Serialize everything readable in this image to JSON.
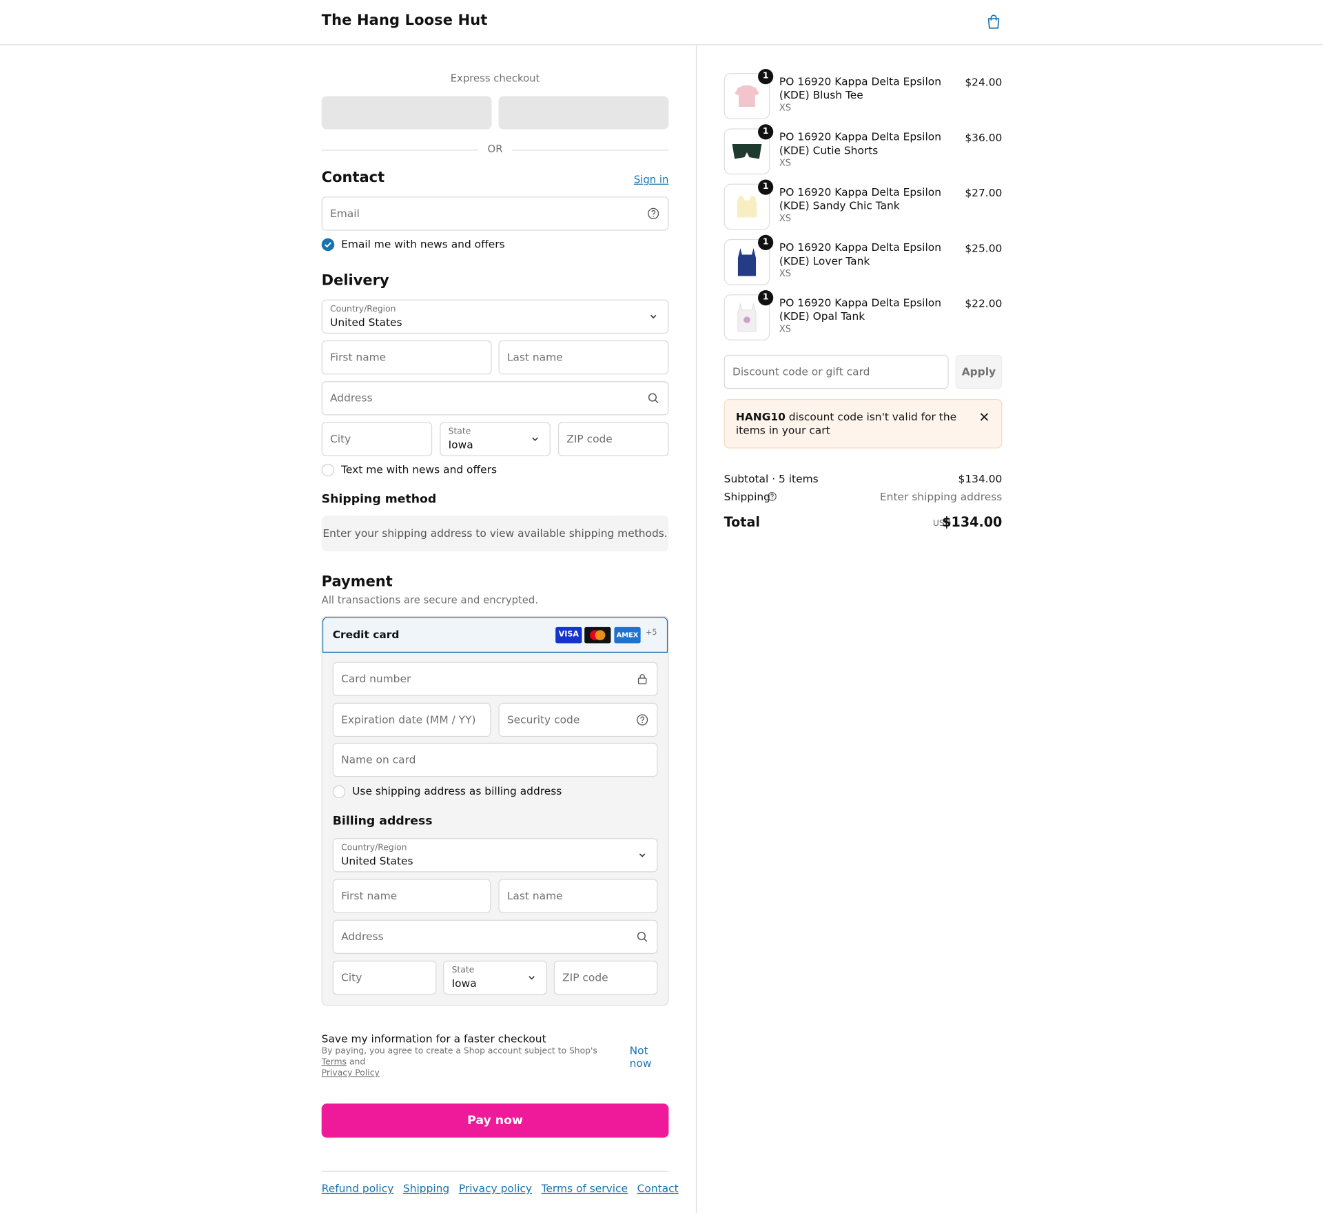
{
  "header": {
    "shop_name": "The Hang Loose Hut",
    "cart_icon": "shopping-bag-icon"
  },
  "express": {
    "title": "Express checkout",
    "or": "OR"
  },
  "contact": {
    "title": "Contact",
    "sign_in": "Sign in",
    "email_placeholder": "Email",
    "newsletter_label": "Email me with news and offers",
    "newsletter_checked": true
  },
  "delivery": {
    "title": "Delivery",
    "country_label": "Country/Region",
    "country_value": "United States",
    "first_name": "First name",
    "last_name": "Last name",
    "address": "Address",
    "city": "City",
    "state_label": "State",
    "state_value": "Iowa",
    "zip": "ZIP code",
    "sms_label": "Text me with news and offers",
    "sms_checked": false
  },
  "shipping_method": {
    "title": "Shipping method",
    "note": "Enter your shipping address to view available shipping methods."
  },
  "payment": {
    "title": "Payment",
    "subtitle": "All transactions are secure and encrypted.",
    "method": "Credit card",
    "brands": [
      "VISA",
      "MC",
      "AMEX"
    ],
    "more_brands": "+5",
    "card_number": "Card number",
    "expiration": "Expiration date (MM / YY)",
    "security_code": "Security code",
    "name_on_card": "Name on card",
    "billing_same_label": "Use shipping address as billing address",
    "billing_same_checked": false
  },
  "billing": {
    "title": "Billing address",
    "country_label": "Country/Region",
    "country_value": "United States",
    "first_name": "First name",
    "last_name": "Last name",
    "address": "Address",
    "city": "City",
    "state_label": "State",
    "state_value": "Iowa",
    "zip": "ZIP code"
  },
  "save_info": {
    "title": "Save my information for a faster checkout",
    "legal_prefix": "By paying, you agree to create a Shop account subject to Shop's",
    "terms": "Terms",
    "and": "and",
    "privacy": "Privacy Policy",
    "not_now": "Not now"
  },
  "pay_button": "Pay now",
  "footer_links": [
    "Refund policy",
    "Shipping",
    "Privacy policy",
    "Terms of service",
    "Contact"
  ],
  "cart": {
    "items": [
      {
        "qty": "1",
        "name": "PO 16920 Kappa Delta Epsilon (KDE) Blush Tee",
        "variant": "XS",
        "price": "$24.00",
        "color": "#f2c4cc"
      },
      {
        "qty": "1",
        "name": "PO 16920 Kappa Delta Epsilon (KDE) Cutie Shorts",
        "variant": "XS",
        "price": "$36.00",
        "color": "#1f3a2e"
      },
      {
        "qty": "1",
        "name": "PO 16920 Kappa Delta Epsilon (KDE) Sandy Chic Tank",
        "variant": "XS",
        "price": "$27.00",
        "color": "#f7efc2"
      },
      {
        "qty": "1",
        "name": "PO 16920 Kappa Delta Epsilon (KDE) Lover Tank",
        "variant": "XS",
        "price": "$25.00",
        "color": "#243b86"
      },
      {
        "qty": "1",
        "name": "PO 16920 Kappa Delta Epsilon (KDE) Opal Tank",
        "variant": "XS",
        "price": "$22.00",
        "color": "#f3eef2"
      }
    ],
    "discount_placeholder": "Discount code or gift card",
    "apply": "Apply",
    "alert_code": "HANG10",
    "alert_text": "discount code isn't valid for the items in your cart",
    "subtotal_label": "Subtotal · 5 items",
    "subtotal_value": "$134.00",
    "shipping_label": "Shipping",
    "shipping_value": "Enter shipping address",
    "total_label": "Total",
    "currency": "USD",
    "total_value": "$134.00"
  },
  "colors": {
    "accent": "#1773b0",
    "pay_button": "#ee1a99",
    "alert_bg": "#fff4ec"
  }
}
